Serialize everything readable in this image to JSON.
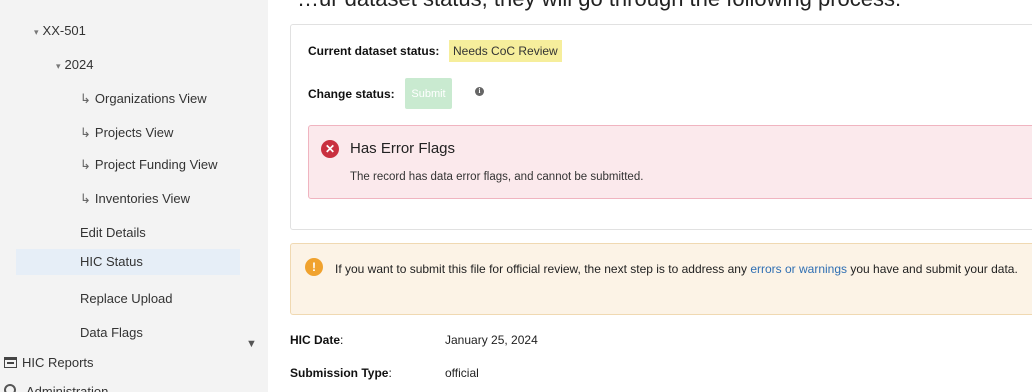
{
  "headline": "…ur dataset status, they will go through the following process:",
  "sidebar": {
    "coc": "XX-501",
    "year": "2024",
    "views": [
      "Organizations View",
      "Projects View",
      "Project Funding View",
      "Inventories View"
    ],
    "actions": [
      "Edit Details",
      "HIC Status",
      "Replace Upload",
      "Data Flags"
    ],
    "reports": "HIC Reports",
    "admin": "Administration"
  },
  "status": {
    "current_label": "Current dataset status:",
    "current_value": "Needs CoC Review",
    "change_label": "Change status:",
    "submit_label": "Submit",
    "submit_color": "#c9ead0"
  },
  "error": {
    "title": "Has Error Flags",
    "message": "The record has data error flags, and cannot be submitted.",
    "color": "#c9303f"
  },
  "warning": {
    "text_before": "If you want to submit this file for official review, the next step is to address any ",
    "link": "errors or warnings",
    "text_after": " you have and submit your data.",
    "color": "#f0a22e"
  },
  "details": {
    "hic_date_label": "HIC Date",
    "hic_date_value": "January 25, 2024",
    "submission_type_label": "Submission Type",
    "submission_type_value": "official"
  }
}
